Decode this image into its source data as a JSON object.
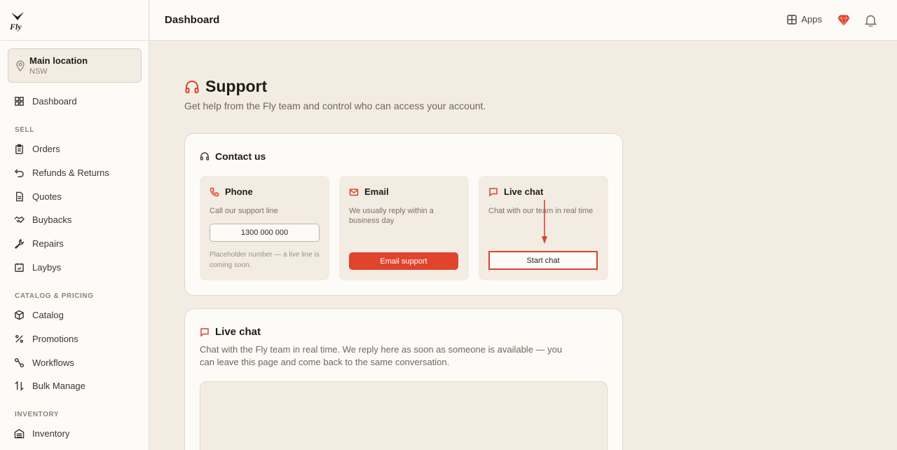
{
  "topbar": {
    "title": "Dashboard",
    "apps_label": "Apps"
  },
  "brand": {
    "logo_text": "Fly",
    "accent_color": "#d8452e"
  },
  "location": {
    "name": "Main location",
    "region": "NSW"
  },
  "sidebar": {
    "dashboard": "Dashboard",
    "sections": {
      "sell": "SELL",
      "catalog": "CATALOG & PRICING",
      "inventory": "INVENTORY"
    },
    "items": {
      "orders": "Orders",
      "refunds": "Refunds & Returns",
      "quotes": "Quotes",
      "buybacks": "Buybacks",
      "repairs": "Repairs",
      "laybys": "Laybys",
      "catalog": "Catalog",
      "promotions": "Promotions",
      "workflows": "Workflows",
      "bulk": "Bulk Manage",
      "inventory": "Inventory"
    }
  },
  "support": {
    "title": "Support",
    "subtitle": "Get help from the Fly team and control who can access your account."
  },
  "contact": {
    "title": "Contact us",
    "phone": {
      "title": "Phone",
      "desc": "Call our support line",
      "number": "1300 000 000",
      "note": "Placeholder number — a live line is coming soon."
    },
    "email": {
      "title": "Email",
      "desc": "We usually reply within a business day",
      "button": "Email support"
    },
    "chat": {
      "title": "Live chat",
      "desc": "Chat with our team in real time",
      "button": "Start chat"
    }
  },
  "live_chat": {
    "title": "Live chat",
    "desc": "Chat with the Fly team in real time. We reply here as soon as someone is available — you can leave this page and come back to the same conversation."
  }
}
